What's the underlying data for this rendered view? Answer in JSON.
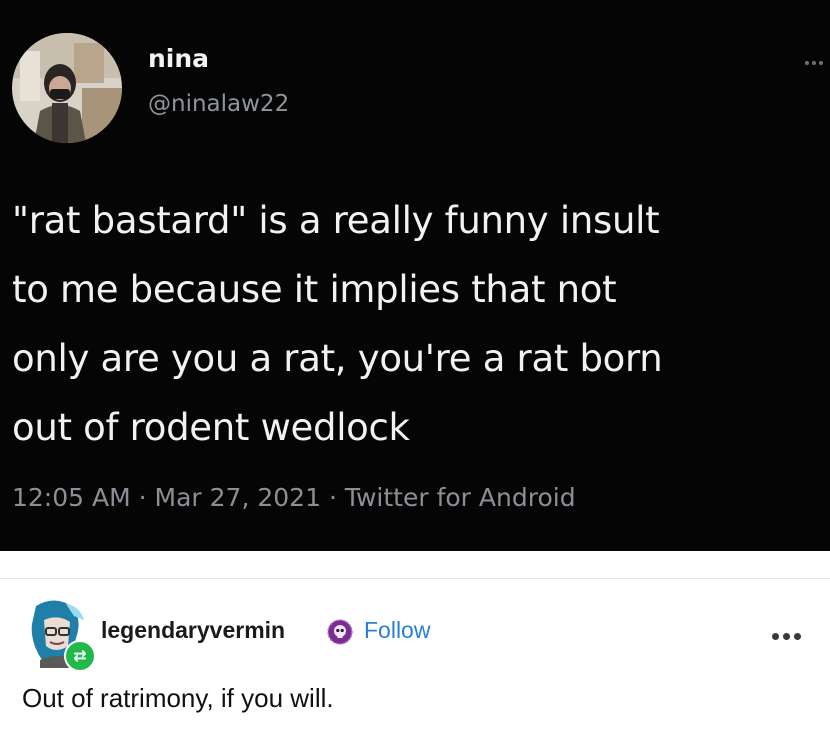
{
  "tweet": {
    "display_name": "nina",
    "handle": "@ninalaw22",
    "text_lines": [
      "\"rat bastard\" is a really funny insult",
      "to me because it implies that not",
      "only are you a rat, you're a rat born",
      "out of rodent wedlock"
    ],
    "time": "12:05 AM",
    "date": "Mar 27, 2021",
    "source": "Twitter for Android",
    "separator": "·",
    "avatar_icon": "profile-photo",
    "more_icon": "ellipsis-icon"
  },
  "reblog": {
    "username": "legendaryvermin",
    "follow_label": "Follow",
    "text": "Out of ratrimony, if you will.",
    "badge_icon": "reblog-icon",
    "badge_glyph": "⇄",
    "verified_icon": "skull-badge-icon",
    "more_icon": "ellipsis-icon"
  },
  "colors": {
    "tweet_background": "#050505",
    "tweet_text": "#f2f2f2",
    "tweet_secondary": "#8f959a",
    "follow_link": "#2b7fd8",
    "reblog_badge": "#23b84a"
  }
}
